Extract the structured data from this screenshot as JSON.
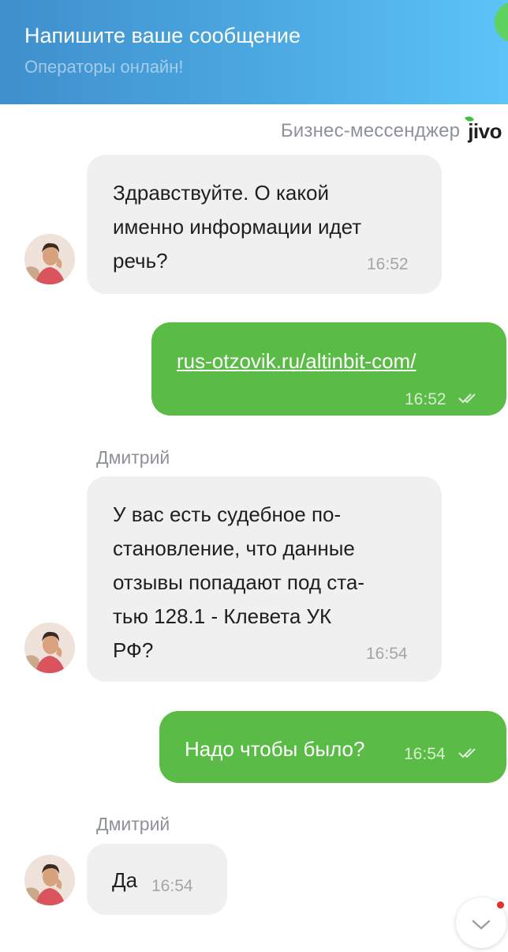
{
  "header": {
    "title": "Напишите ваше сообщение",
    "subtitle": "Операторы онлайн!"
  },
  "branding": {
    "label": "Бизнес-мессенджер",
    "logo_text": "jivo"
  },
  "messages": [
    {
      "direction": "incoming",
      "sender": "",
      "lines": [
        "Здравствуйте. О какой",
        "именно информации идет",
        "речь?"
      ],
      "time": "16:52"
    },
    {
      "direction": "outgoing",
      "text": "rus-otzovik.ru/altinbit-com/",
      "is_link": true,
      "time": "16:52",
      "status": "read"
    },
    {
      "direction": "incoming",
      "sender": "Дмитрий",
      "lines": [
        "У вас есть судебное по-",
        "становление, что данные",
        "отзывы попадают под ста-",
        "тью 128.1 - Клевета УК",
        "РФ?"
      ],
      "time": "16:54"
    },
    {
      "direction": "outgoing",
      "text": "Надо чтобы было?",
      "is_link": false,
      "time": "16:54",
      "status": "read"
    },
    {
      "direction": "incoming",
      "sender": "Дмитрий",
      "lines": [
        "Да"
      ],
      "time": "16:54"
    }
  ],
  "colors": {
    "header_gradient_start": "#3f8fcd",
    "header_gradient_end": "#5cc4f7",
    "outgoing_bubble": "#5abc46",
    "incoming_bubble": "#f0f0f0",
    "unread_dot": "#e03030"
  },
  "icons": {
    "read_status": "double-check-icon",
    "scroll_down": "chevron-down-icon",
    "avatar": "operator-avatar"
  }
}
